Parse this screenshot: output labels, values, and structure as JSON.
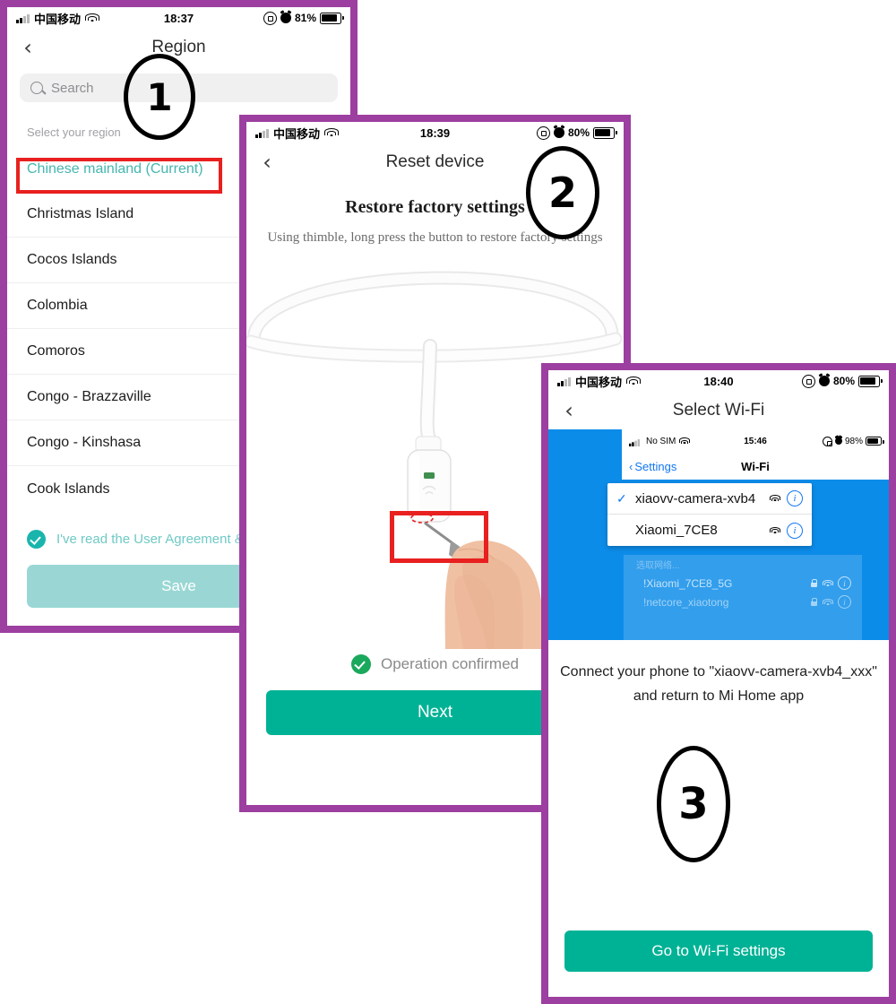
{
  "panel1": {
    "status": {
      "carrier": "中国移动",
      "time": "18:37",
      "battery": "81%",
      "signal_icon": "signal-bars-icon",
      "wifi_icon": "wifi-icon",
      "rotation_icon": "rotation-lock-icon",
      "alarm_icon": "alarm-clock-icon",
      "battery_icon": "battery-icon"
    },
    "nav": {
      "back_icon": "chevron-left-icon",
      "title": "Region"
    },
    "search": {
      "placeholder": "Search",
      "icon": "search-icon"
    },
    "section_label": "Select your region",
    "regions": [
      {
        "name": "Chinese mainland (Current)",
        "current": true
      },
      {
        "name": "Christmas Island",
        "current": false
      },
      {
        "name": "Cocos Islands",
        "current": false
      },
      {
        "name": "Colombia",
        "current": false
      },
      {
        "name": "Comoros",
        "current": false
      },
      {
        "name": "Congo - Brazzaville",
        "current": false
      },
      {
        "name": "Congo - Kinshasa",
        "current": false
      },
      {
        "name": "Cook Islands",
        "current": false
      }
    ],
    "agreement": "I've read the User Agreement & P",
    "save_label": "Save",
    "highlight_color": "#e8201f",
    "accent_color": "#45b6b0"
  },
  "panel2": {
    "status": {
      "carrier": "中国移动",
      "time": "18:39",
      "battery": "80%"
    },
    "nav": {
      "title": "Reset device"
    },
    "heading": "Restore factory settings",
    "subheading": "Using thimble, long press the button to restore factory settings",
    "confirm_text": "Operation confirmed",
    "next_label": "Next",
    "accent_color": "#00b295",
    "highlight_color": "#e8201f"
  },
  "panel3": {
    "status": {
      "carrier": "中国移动",
      "time": "18:40",
      "battery": "80%"
    },
    "nav": {
      "title": "Select Wi-Fi"
    },
    "inner_status": {
      "carrier": "No SIM",
      "time": "15:46",
      "battery": "98%"
    },
    "inner_nav": {
      "back_label": "Settings",
      "title": "Wi-Fi"
    },
    "networks": [
      {
        "name": "xiaovv-camera-xvb4",
        "checked": true,
        "locked": false
      },
      {
        "name": "Xiaomi_7CE8",
        "checked": false,
        "locked": false
      }
    ],
    "faded_header": "选取网络...",
    "faded_networks": [
      {
        "name": "!Xiaomi_7CE8_5G",
        "locked": true
      },
      {
        "name": "!netcore_xiaotong",
        "locked": true
      }
    ],
    "hint_line1": "Connect your phone to \"xiaovv-camera-xvb4_xxx\"",
    "hint_line2": "and return to Mi Home app",
    "button_label": "Go to Wi-Fi settings",
    "accent_color": "#00b295"
  },
  "markers": {
    "one": "1",
    "two": "2",
    "three": "3"
  },
  "frame_color": "#9c3fa0"
}
